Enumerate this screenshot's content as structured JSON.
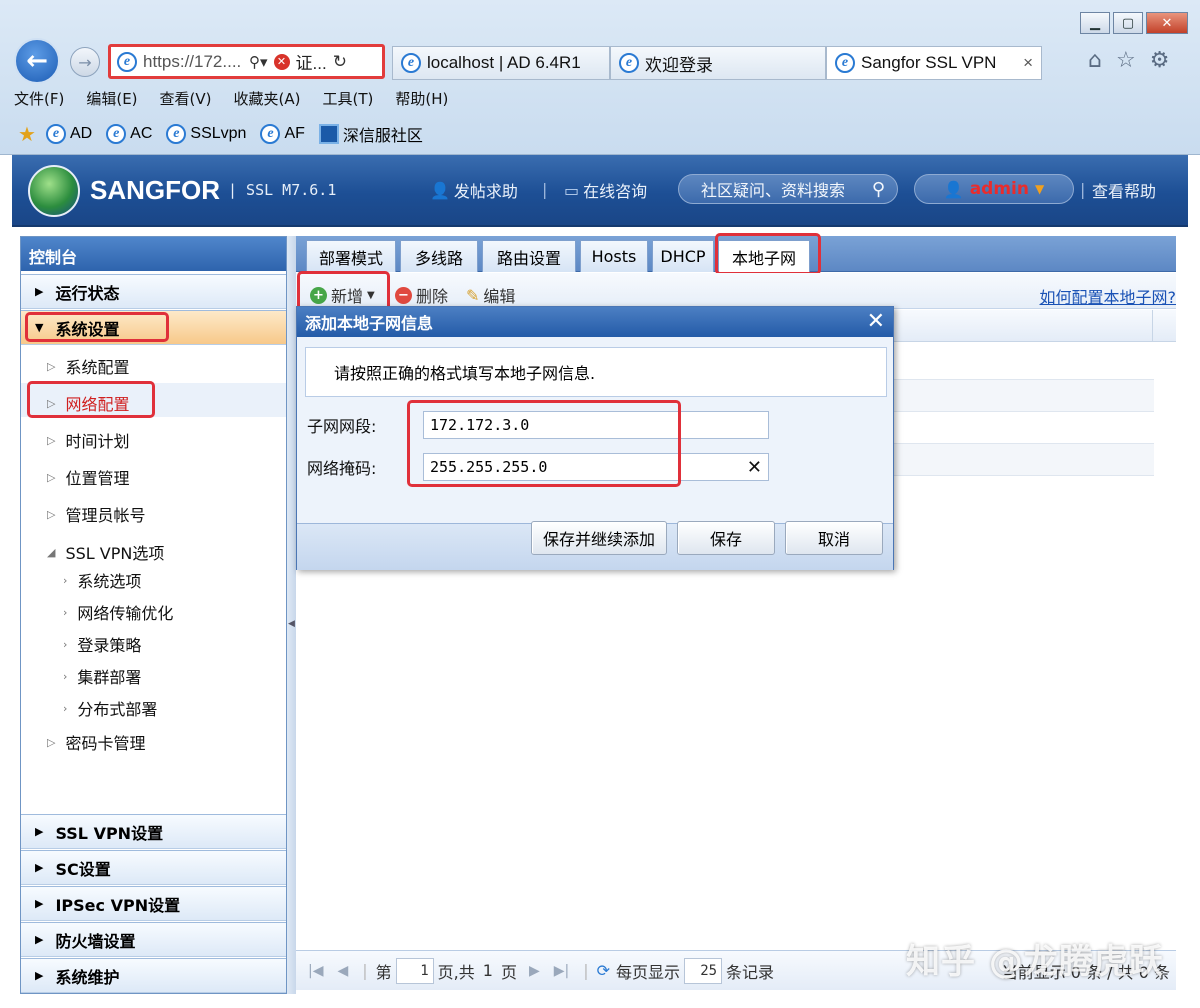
{
  "browser": {
    "address": "https://172....",
    "cert_label": "证...",
    "tabs": [
      {
        "label": "localhost | AD 6.4R1"
      },
      {
        "label": "欢迎登录"
      },
      {
        "label": "Sangfor SSL VPN",
        "close": "×"
      }
    ],
    "menu": [
      "文件(F)",
      "编辑(E)",
      "查看(V)",
      "收藏夹(A)",
      "工具(T)",
      "帮助(H)"
    ],
    "favorites": [
      "AD",
      "AC",
      "SSLvpn",
      "AF",
      "深信服社区"
    ]
  },
  "header": {
    "brand": "SANGFOR",
    "version": "| SSL M7.6.1",
    "links": {
      "post_help": "发帖求助",
      "online_consult": "在线咨询"
    },
    "search_placeholder": "社区疑问、资料搜索",
    "user": "admin",
    "help": "查看帮助"
  },
  "sidebar": {
    "title": "控制台",
    "sections_top": [
      {
        "label": "运行状态"
      },
      {
        "label": "系统设置"
      }
    ],
    "items": [
      {
        "label": "系统配置"
      },
      {
        "label": "网络配置"
      },
      {
        "label": "时间计划"
      },
      {
        "label": "位置管理"
      },
      {
        "label": "管理员帐号"
      },
      {
        "label": "SSL VPN选项"
      }
    ],
    "subitems": [
      "系统选项",
      "网络传输优化",
      "登录策略",
      "集群部署",
      "分布式部署"
    ],
    "last_item": "密码卡管理",
    "sections_bottom": [
      "SSL VPN设置",
      "SC设置",
      "IPSec VPN设置",
      "防火墙设置",
      "系统维护"
    ]
  },
  "content": {
    "tabs": [
      "部署模式",
      "多线路",
      "路由设置",
      "Hosts",
      "DHCP",
      "本地子网"
    ],
    "active_tab": "本地子网",
    "toolbar": {
      "add": "新增",
      "delete": "删除",
      "edit": "编辑"
    },
    "howto": "如何配置本地子网?"
  },
  "modal": {
    "title": "添加本地子网信息",
    "tip": "请按照正确的格式填写本地子网信息.",
    "subnet_label": "子网网段:",
    "subnet_value": "172.172.3.0",
    "mask_label": "网络掩码:",
    "mask_value": "255.255.255.0",
    "buttons": {
      "save_continue": "保存并继续添加",
      "save": "保存",
      "cancel": "取消"
    }
  },
  "pager": {
    "prefix": "第",
    "page": "1",
    "of": "页,共",
    "total_pages": "1",
    "suffix": "页",
    "per_page_label": "每页显示",
    "per_page": "25",
    "records_label": "条记录",
    "status": "当前显示 0 条 / 共 0 条"
  },
  "watermark": "知乎 @龙腾虎跃"
}
